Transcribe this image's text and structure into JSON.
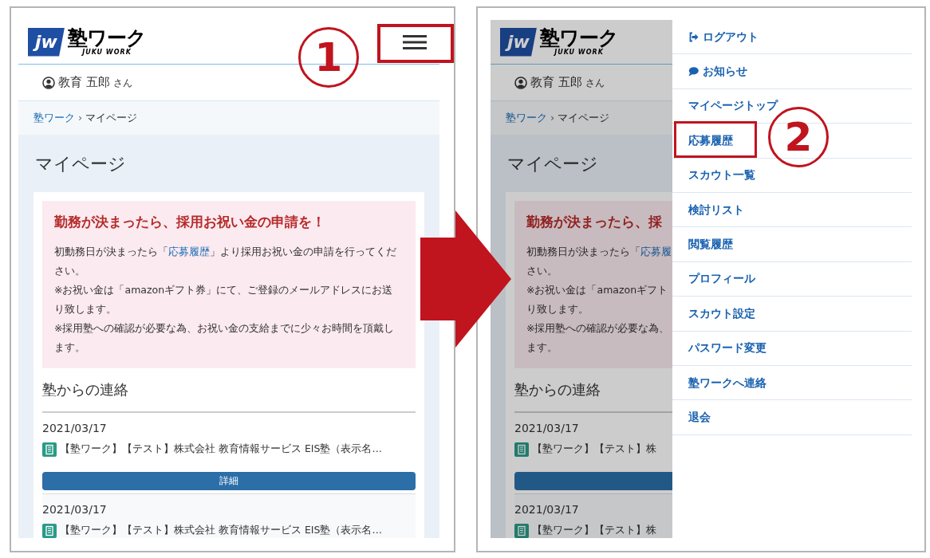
{
  "screens": [
    {
      "dimmed": false,
      "menu_button": {
        "annotated": true
      },
      "logo": {
        "mark": "jw",
        "title": "塾ワーク",
        "subtitle": "JUKU WORK"
      },
      "user": {
        "name": "教育 五郎",
        "suffix": "さん"
      },
      "breadcrumb": {
        "separator": "›",
        "items": [
          {
            "text": "塾ワーク",
            "link": true
          },
          {
            "text": "マイページ",
            "link": false
          }
        ]
      },
      "page_title": "マイページ",
      "notice": {
        "title": "勤務が決まったら、採用お祝い金の申請を！",
        "lines": [
          [
            {
              "text": "初動務日が決まったら「",
              "link": false
            },
            {
              "text": "応募履歴",
              "link": true
            },
            {
              "text": "」より採用お祝い金の申請を行ってくだ",
              "link": false
            }
          ],
          [
            {
              "text": "さい。",
              "link": false
            }
          ],
          [
            {
              "text": "※お祝い金は「amazonギフト券」にて、ご登録のメールアドレスにお送",
              "link": false
            }
          ],
          [
            {
              "text": "り致します。",
              "link": false
            }
          ],
          [
            {
              "text": "※採用塾への確認が必要な為、お祝い金の支給までに少々お時間を頂戴し",
              "link": false
            }
          ],
          [
            {
              "text": "ます。",
              "link": false
            }
          ]
        ]
      },
      "section_title": "塾からの連絡",
      "messages": [
        {
          "date": "2021/03/17",
          "text": "【塾ワーク】【テスト】株式会社 教育情報サービス EIS塾（表示名…",
          "button": "詳細"
        },
        {
          "date": "2021/03/17",
          "text": "【塾ワーク】【テスト】株式会社 教育情報サービス EIS塾（表示名…"
        }
      ]
    },
    {
      "dimmed": true,
      "logo": {
        "mark": "jw",
        "title": "塾ワーク",
        "subtitle": "JUKU WORK"
      },
      "user": {
        "name": "教育 五郎",
        "suffix": "さん"
      },
      "breadcrumb": {
        "separator": "›",
        "items": [
          {
            "text": "塾ワーク",
            "link": true
          },
          {
            "text": "マイページ",
            "link": false
          }
        ]
      },
      "page_title": "マイページ",
      "notice": {
        "title": "勤務が決まったら、採",
        "lines": [
          [
            {
              "text": "初動務日が決まったら「",
              "link": false
            },
            {
              "text": "応募履",
              "link": true
            }
          ],
          [
            {
              "text": "さい。",
              "link": false
            }
          ],
          [
            {
              "text": "※お祝い金は「amazonギフト",
              "link": false
            }
          ],
          [
            {
              "text": "り致します。",
              "link": false
            }
          ],
          [
            {
              "text": "※採用塾への確認が必要な為、",
              "link": false
            }
          ],
          [
            {
              "text": "ます。",
              "link": false
            }
          ]
        ]
      },
      "section_title": "塾からの連絡",
      "messages": [
        {
          "date": "2021/03/17",
          "text": "【塾ワーク】【テスト】株",
          "button": true
        },
        {
          "date": "2021/03/17",
          "text": "【塾ワーク】【テスト】株"
        }
      ],
      "menu": {
        "items": [
          {
            "label": "ログアウト",
            "kind": "logout",
            "annotated": false
          },
          {
            "label": "お知らせ",
            "kind": "notice",
            "annotated": false
          },
          {
            "label": "マイページトップ",
            "kind": "plain",
            "annotated": false
          },
          {
            "label": "応募履歴",
            "kind": "plain",
            "annotated": true
          },
          {
            "label": "スカウト一覧",
            "kind": "plain",
            "annotated": false
          },
          {
            "label": "検討リスト",
            "kind": "plain",
            "annotated": false
          },
          {
            "label": "閲覧履歴",
            "kind": "plain",
            "annotated": false
          },
          {
            "label": "プロフィール",
            "kind": "plain",
            "annotated": false
          },
          {
            "label": "スカウト設定",
            "kind": "plain",
            "annotated": false
          },
          {
            "label": "パスワード変更",
            "kind": "plain",
            "annotated": false
          },
          {
            "label": "塾ワークへ連絡",
            "kind": "plain",
            "annotated": false
          },
          {
            "label": "退会",
            "kind": "plain",
            "annotated": false
          }
        ]
      }
    }
  ],
  "markers": [
    {
      "label": "1"
    },
    {
      "label": "2"
    }
  ]
}
